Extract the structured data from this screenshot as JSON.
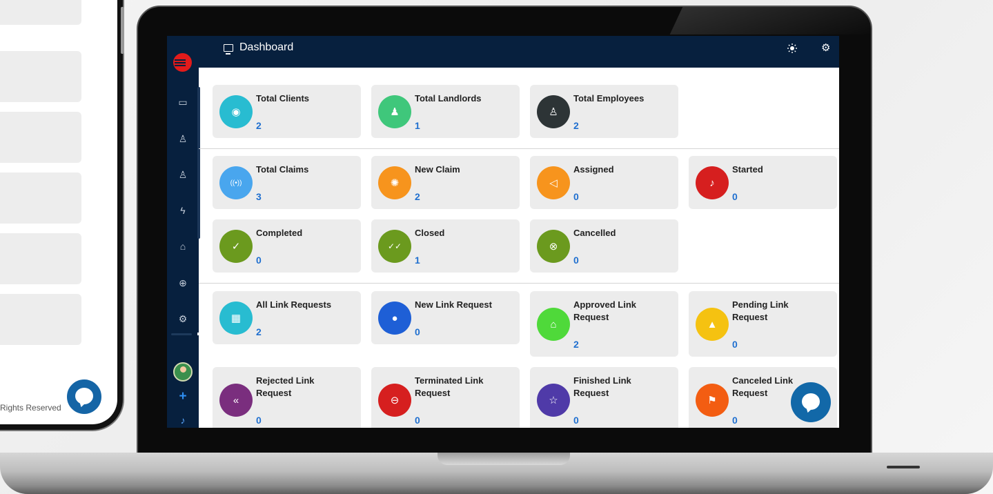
{
  "phone": {
    "footer_text": "Rights Reserved"
  },
  "header": {
    "title": "Dashboard",
    "title_icon": "monitor-icon",
    "actions": [
      "sun-icon",
      "gear-icon"
    ]
  },
  "sidebar": {
    "items": [
      "monitor-icon",
      "users-icon",
      "user-icon",
      "lightning-icon",
      "home-icon",
      "download-circle-icon",
      "gear-icon"
    ],
    "footer": [
      "avatar",
      "plus-icon",
      "bell-icon"
    ]
  },
  "colors": {
    "nav_bg": "#07203e",
    "card_bg": "#ececec",
    "value_blue": "#1f6fcf",
    "accent_red": "#e21b1b"
  },
  "stats": {
    "total_clients": {
      "label": "Total Clients",
      "value": "2",
      "color": "#28bcd1",
      "icon": "location-pin-icon"
    },
    "total_landlords": {
      "label": "Total Landlords",
      "value": "1",
      "color": "#3fc77b",
      "icon": "person-icon"
    },
    "total_employees": {
      "label": "Total Employees",
      "value": "2",
      "color": "#2d3436",
      "icon": "user-add-icon"
    },
    "total_claims": {
      "label": "Total Claims",
      "value": "3",
      "color": "#49a6ee",
      "icon": "broadcast-icon"
    },
    "new_claim": {
      "label": "New Claim",
      "value": "2",
      "color": "#f7941d",
      "icon": "loading-icon"
    },
    "assigned": {
      "label": "Assigned",
      "value": "0",
      "color": "#f7941d",
      "icon": "send-icon"
    },
    "started": {
      "label": "Started",
      "value": "0",
      "color": "#d61f1f",
      "icon": "bell-icon"
    },
    "completed": {
      "label": "Completed",
      "value": "0",
      "color": "#6b9a1e",
      "icon": "check-icon"
    },
    "closed": {
      "label": "Closed",
      "value": "1",
      "color": "#6b9a1e",
      "icon": "double-check-icon"
    },
    "cancelled": {
      "label": "Cancelled",
      "value": "0",
      "color": "#6b9a1e",
      "icon": "x-circle-icon"
    },
    "all_link_requests": {
      "label": "All Link Requests",
      "value": "2",
      "color": "#28bcd1",
      "icon": "building-icon"
    },
    "new_link_request": {
      "label": "New Link Request",
      "value": "0",
      "color": "#1e5fd6",
      "icon": "drop-icon"
    },
    "approved_link_request": {
      "label": "Approved Link Request",
      "value": "2",
      "color": "#4fd93a",
      "icon": "house-check-icon"
    },
    "pending_link_request": {
      "label": "Pending Link Request",
      "value": "0",
      "color": "#f5c211",
      "icon": "thumbs-up-icon"
    },
    "rejected_link_request": {
      "label": "Rejected Link Request",
      "value": "0",
      "color": "#7a2e7e",
      "icon": "reply-all-icon"
    },
    "terminated_link_request": {
      "label": "Terminated Link Request",
      "value": "0",
      "color": "#d61f1f",
      "icon": "minus-circle-icon"
    },
    "finished_link_request": {
      "label": "Finished Link Request",
      "value": "0",
      "color": "#4f3aa8",
      "icon": "star-icon"
    },
    "canceled_link_request": {
      "label": "Canceled Link Request",
      "value": "0",
      "color": "#f35d12",
      "icon": "flag-icon"
    }
  }
}
